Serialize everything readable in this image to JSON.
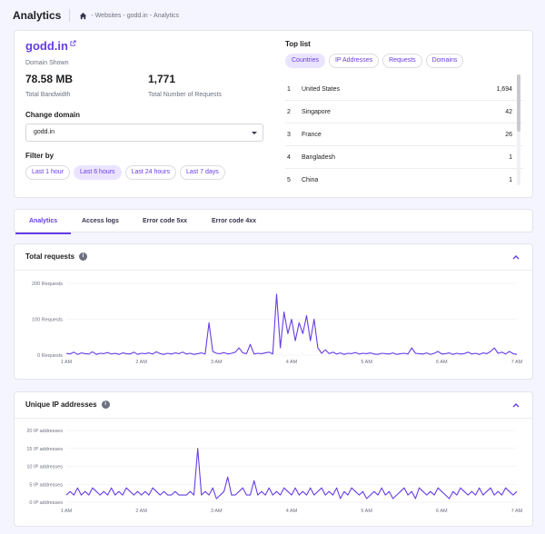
{
  "header": {
    "title": "Analytics",
    "breadcrumbs": [
      "-",
      "Websites",
      "-",
      "godd.in",
      "-",
      "Analytics"
    ]
  },
  "overview": {
    "domain": "godd.in",
    "domain_caption": "Domain Shown",
    "bandwidth": "78.58 MB",
    "bandwidth_label": "Total Bandwidth",
    "requests": "1,771",
    "requests_label": "Total Number of Requests",
    "change_domain_label": "Change domain",
    "domain_select_value": "godd.in",
    "filter_label": "Filter by",
    "filters": [
      "Last 1 hour",
      "Last 6 hours",
      "Last 24 hours",
      "Last 7 days"
    ],
    "active_filter": 1
  },
  "toplist": {
    "title": "Top list",
    "tabs": [
      "Countries",
      "IP Addresses",
      "Requests",
      "Domains"
    ],
    "active_tab": 0,
    "rows": [
      {
        "rank": "1",
        "name": "United States",
        "value": "1,694"
      },
      {
        "rank": "2",
        "name": "Singapore",
        "value": "42"
      },
      {
        "rank": "3",
        "name": "France",
        "value": "26"
      },
      {
        "rank": "4",
        "name": "Bangladesh",
        "value": "1"
      },
      {
        "rank": "5",
        "name": "China",
        "value": "1"
      }
    ]
  },
  "tabs": [
    "Analytics",
    "Access logs",
    "Error code 5xx",
    "Error code 4xx"
  ],
  "active_tab": 0,
  "colors": {
    "accent": "#673de6",
    "accent_light": "#ebe4ff",
    "series": "#673de6"
  },
  "chart_requests_title": "Total requests",
  "chart_ips_title": "Unique IP addresses",
  "chart_data": [
    {
      "type": "line",
      "title": "Total requests",
      "yticks": [
        "0 Requests",
        "100 Requests",
        "200 Requests"
      ],
      "ylim": [
        0,
        200
      ],
      "xticks": [
        "1 AM",
        "2 AM",
        "3 AM",
        "4 AM",
        "5 AM",
        "6 AM",
        "7 AM"
      ],
      "xlim": [
        1,
        7
      ],
      "grid": true,
      "series": [
        {
          "x": [
            1.0,
            1.05,
            1.1,
            1.15,
            1.2,
            1.25,
            1.3,
            1.35,
            1.4,
            1.45,
            1.5,
            1.55,
            1.6,
            1.65,
            1.7,
            1.75,
            1.8,
            1.85,
            1.9,
            1.95,
            2.0,
            2.05,
            2.1,
            2.15,
            2.2,
            2.25,
            2.3,
            2.35,
            2.4,
            2.45,
            2.5,
            2.55,
            2.6,
            2.65,
            2.7,
            2.75,
            2.8,
            2.85,
            2.9,
            2.95,
            3.0,
            3.05,
            3.1,
            3.15,
            3.2,
            3.25,
            3.3,
            3.35,
            3.4,
            3.45,
            3.5,
            3.55,
            3.6,
            3.65,
            3.7,
            3.75,
            3.8,
            3.85,
            3.9,
            3.95,
            4.0,
            4.05,
            4.1,
            4.15,
            4.2,
            4.25,
            4.3,
            4.35,
            4.4,
            4.45,
            4.5,
            4.55,
            4.6,
            4.65,
            4.7,
            4.75,
            4.8,
            4.85,
            4.9,
            4.95,
            5.0,
            5.05,
            5.1,
            5.15,
            5.2,
            5.25,
            5.3,
            5.35,
            5.4,
            5.45,
            5.5,
            5.55,
            5.6,
            5.65,
            5.7,
            5.75,
            5.8,
            5.85,
            5.9,
            5.95,
            6.0,
            6.05,
            6.1,
            6.15,
            6.2,
            6.25,
            6.3,
            6.35,
            6.4,
            6.45,
            6.5,
            6.55,
            6.6,
            6.65,
            6.7,
            6.75,
            6.8,
            6.85,
            6.9,
            6.95,
            7.0
          ],
          "y": [
            5,
            3,
            8,
            2,
            6,
            4,
            3,
            9,
            2,
            5,
            4,
            7,
            3,
            5,
            2,
            6,
            4,
            3,
            8,
            2,
            5,
            4,
            6,
            3,
            9,
            4,
            2,
            5,
            3,
            6,
            4,
            8,
            3,
            5,
            2,
            4,
            6,
            3,
            90,
            10,
            5,
            4,
            7,
            3,
            5,
            8,
            20,
            6,
            4,
            30,
            3,
            5,
            4,
            6,
            8,
            3,
            170,
            20,
            120,
            60,
            100,
            40,
            90,
            60,
            110,
            40,
            100,
            20,
            5,
            15,
            4,
            8,
            3,
            6,
            2,
            5,
            4,
            7,
            3,
            5,
            4,
            6,
            3,
            2,
            5,
            4,
            3,
            6,
            2,
            4,
            5,
            3,
            20,
            5,
            4,
            3,
            6,
            2,
            5,
            10,
            3,
            4,
            6,
            2,
            5,
            3,
            4,
            8,
            3,
            5,
            2,
            6,
            4,
            10,
            20,
            5,
            8,
            3,
            10,
            4,
            2
          ]
        }
      ]
    },
    {
      "type": "line",
      "title": "Unique IP addresses",
      "yticks": [
        "0 IP addresses",
        "5 IP addresses",
        "10 IP addresses",
        "15 IP addresses",
        "20 IP addresses"
      ],
      "ylim": [
        0,
        20
      ],
      "xticks": [
        "1 AM",
        "2 AM",
        "3 AM",
        "4 AM",
        "5 AM",
        "6 AM",
        "7 AM"
      ],
      "xlim": [
        1,
        7
      ],
      "grid": true,
      "series": [
        {
          "x": [
            1.0,
            1.05,
            1.1,
            1.15,
            1.2,
            1.25,
            1.3,
            1.35,
            1.4,
            1.45,
            1.5,
            1.55,
            1.6,
            1.65,
            1.7,
            1.75,
            1.8,
            1.85,
            1.9,
            1.95,
            2.0,
            2.05,
            2.1,
            2.15,
            2.2,
            2.25,
            2.3,
            2.35,
            2.4,
            2.45,
            2.5,
            2.55,
            2.6,
            2.65,
            2.7,
            2.75,
            2.8,
            2.85,
            2.9,
            2.95,
            3.0,
            3.05,
            3.1,
            3.15,
            3.2,
            3.25,
            3.3,
            3.35,
            3.4,
            3.45,
            3.5,
            3.55,
            3.6,
            3.65,
            3.7,
            3.75,
            3.8,
            3.85,
            3.9,
            3.95,
            4.0,
            4.05,
            4.1,
            4.15,
            4.2,
            4.25,
            4.3,
            4.35,
            4.4,
            4.45,
            4.5,
            4.55,
            4.6,
            4.65,
            4.7,
            4.75,
            4.8,
            4.85,
            4.9,
            4.95,
            5.0,
            5.05,
            5.1,
            5.15,
            5.2,
            5.25,
            5.3,
            5.35,
            5.4,
            5.45,
            5.5,
            5.55,
            5.6,
            5.65,
            5.7,
            5.75,
            5.8,
            5.85,
            5.9,
            5.95,
            6.0,
            6.05,
            6.1,
            6.15,
            6.2,
            6.25,
            6.3,
            6.35,
            6.4,
            6.45,
            6.5,
            6.55,
            6.6,
            6.65,
            6.7,
            6.75,
            6.8,
            6.85,
            6.9,
            6.95,
            7.0
          ],
          "y": [
            2,
            3,
            2,
            4,
            2,
            3,
            2,
            4,
            3,
            2,
            3,
            2,
            4,
            2,
            3,
            2,
            4,
            3,
            2,
            3,
            2,
            3,
            2,
            4,
            3,
            2,
            3,
            2,
            2,
            3,
            2,
            2,
            2,
            3,
            2,
            15,
            2,
            3,
            2,
            4,
            1,
            2,
            3,
            7,
            2,
            2,
            3,
            4,
            2,
            2,
            6,
            2,
            3,
            2,
            4,
            2,
            3,
            2,
            4,
            3,
            2,
            4,
            2,
            3,
            2,
            4,
            2,
            3,
            4,
            2,
            3,
            2,
            4,
            1,
            3,
            2,
            4,
            3,
            2,
            3,
            1,
            2,
            3,
            2,
            4,
            2,
            3,
            1,
            2,
            3,
            4,
            2,
            3,
            1,
            4,
            3,
            2,
            3,
            2,
            4,
            3,
            2,
            1,
            3,
            2,
            4,
            3,
            2,
            3,
            2,
            4,
            2,
            3,
            4,
            2,
            3,
            2,
            4,
            3,
            2,
            3
          ]
        }
      ]
    }
  ]
}
